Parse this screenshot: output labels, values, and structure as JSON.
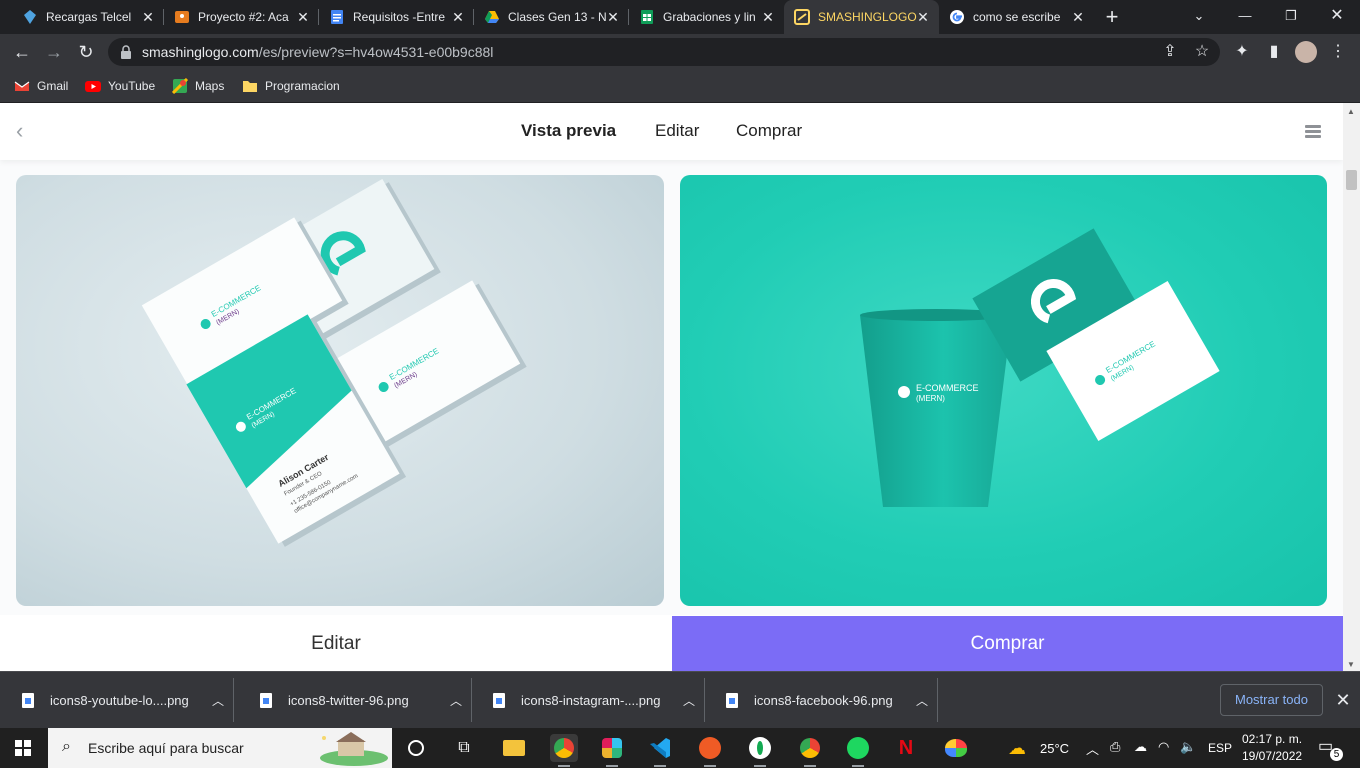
{
  "browser": {
    "tabs": [
      {
        "title": "Recargas Telcel",
        "icon": "telcel-icon",
        "color": "#4fa3e0"
      },
      {
        "title": "Proyecto #2: Aca",
        "icon": "slides-icon",
        "color": "#e67c1f"
      },
      {
        "title": "Requisitos -Entre",
        "icon": "docs-icon",
        "color": "#4285f4"
      },
      {
        "title": "Clases Gen 13 - N",
        "icon": "drive-icon",
        "color": "#fbbc04"
      },
      {
        "title": "Grabaciones y lin",
        "icon": "sheets-icon",
        "color": "#0f9d58"
      },
      {
        "title": "SMASHINGLOGO",
        "icon": "smashinglogo-icon",
        "color": "#fdd663",
        "active": true
      },
      {
        "title": "como se escribe",
        "icon": "google-icon",
        "color": "#ffffff"
      }
    ],
    "url_domain": "smashinglogo.com",
    "url_path": "/es/preview?s=hv4ow4531-e00b9c88l",
    "bookmarks": [
      {
        "label": "Gmail",
        "icon": "gmail-icon"
      },
      {
        "label": "YouTube",
        "icon": "youtube-icon"
      },
      {
        "label": "Maps",
        "icon": "maps-icon"
      },
      {
        "label": "Programacion",
        "icon": "folder-icon"
      }
    ]
  },
  "site": {
    "nav": {
      "preview": "Vista previa",
      "edit": "Editar",
      "buy": "Comprar"
    },
    "mockups": {
      "business_cards": {
        "brand_line1": "E-COMMERCE",
        "brand_line2": "(MERN)",
        "person_name": "Alison Carter",
        "person_role": "Founder & CEO",
        "person_phone": "+1 235-586-0150",
        "person_email": "office@companyname.com"
      },
      "cup": {
        "brand_line1": "E-COMMERCE",
        "brand_line2": "(MERN)"
      }
    },
    "bottom": {
      "edit": "Editar",
      "buy": "Comprar"
    },
    "colors": {
      "accent": "#7b6cf6",
      "teal": "#21cdb5"
    }
  },
  "downloads": {
    "items": [
      "icons8-youtube-lo....png",
      "icons8-twitter-96.png",
      "icons8-instagram-....png",
      "icons8-facebook-96.png"
    ],
    "show_all": "Mostrar todo"
  },
  "taskbar": {
    "search_placeholder": "Escribe aquí para buscar",
    "weather": "25°C",
    "language": "ESP",
    "time": "02:17 p. m.",
    "date": "19/07/2022",
    "notifications": "5"
  }
}
